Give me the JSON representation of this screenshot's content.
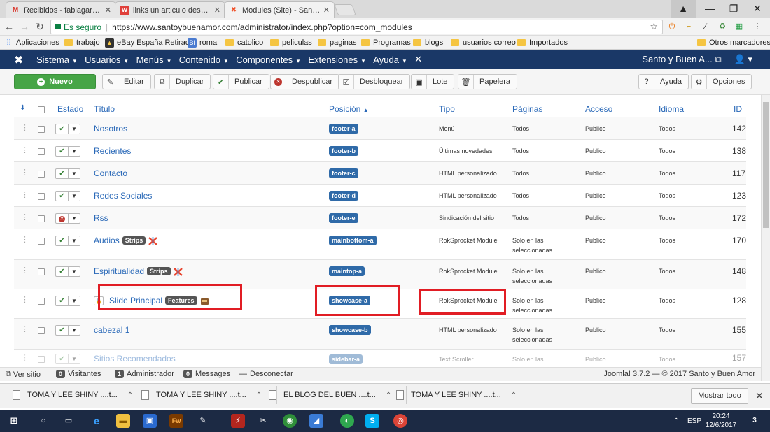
{
  "browser": {
    "tabs": [
      {
        "label": "Recibidos - fabiagarre@...",
        "icon": "gmail-icon",
        "active": false
      },
      {
        "label": "links un articulo desde u...",
        "icon": "wattpad-icon",
        "active": false
      },
      {
        "label": "Modules (Site) - Santo y...",
        "icon": "joomla-icon",
        "active": true
      }
    ],
    "secure_label": "Es seguro",
    "url": "https://www.santoybuenamor.com/administrator/index.php?option=com_modules",
    "bookmarks": [
      "Aplicaciones",
      "trabajo",
      "eBay España Retirad",
      "roma",
      "catolico",
      "peliculas",
      "paginas",
      "Programas",
      "blogs",
      "usuarios correo",
      "Importados"
    ],
    "other_bookmarks": "Otros marcadores"
  },
  "joomla": {
    "menu": [
      "Sistema",
      "Usuarios",
      "Menús",
      "Contenido",
      "Componentes",
      "Extensiones",
      "Ayuda"
    ],
    "site_name": "Santo y Buen A...",
    "toolbar": {
      "new": "Nuevo",
      "edit": "Editar",
      "duplicate": "Duplicar",
      "publish": "Publicar",
      "unpublish": "Despublicar",
      "unlock": "Desbloquear",
      "batch": "Lote",
      "trash": "Papelera",
      "help": "Ayuda",
      "options": "Opciones"
    },
    "table": {
      "headers": {
        "status": "Estado",
        "title": "Título",
        "position": "Posición",
        "type": "Tipo",
        "pages": "Páginas",
        "access": "Acceso",
        "language": "Idioma",
        "id": "ID"
      },
      "rows": [
        {
          "title": "Nosotros",
          "badge": "",
          "position": "footer-a",
          "type": "Menú",
          "pages": "Todos",
          "pages2": "",
          "access": "Publico",
          "language": "Todos",
          "id": "142",
          "published": true
        },
        {
          "title": "Recientes",
          "badge": "",
          "position": "footer-b",
          "type": "Últimas novedades",
          "pages": "Todos",
          "pages2": "",
          "access": "Publico",
          "language": "Todos",
          "id": "138",
          "published": true
        },
        {
          "title": "Contacto",
          "badge": "",
          "position": "footer-c",
          "type": "HTML personalizado",
          "pages": "Todos",
          "pages2": "",
          "access": "Publico",
          "language": "Todos",
          "id": "117",
          "published": true
        },
        {
          "title": "Redes Sociales",
          "badge": "",
          "position": "footer-d",
          "type": "HTML personalizado",
          "pages": "Todos",
          "pages2": "",
          "access": "Publico",
          "language": "Todos",
          "id": "123",
          "published": true
        },
        {
          "title": "Rss",
          "badge": "",
          "position": "footer-e",
          "type": "Sindicación del sitio",
          "pages": "Todos",
          "pages2": "",
          "access": "Publico",
          "language": "Todos",
          "id": "172",
          "published": false
        },
        {
          "title": "Audios",
          "badge": "Strips",
          "position": "mainbottom-a",
          "type": "RokSprocket Module",
          "pages": "Solo en las",
          "pages2": "seleccionadas",
          "access": "Publico",
          "language": "Todos",
          "id": "170",
          "published": true
        },
        {
          "title": "Espiritualidad",
          "badge": "Strips",
          "position": "maintop-a",
          "type": "RokSprocket Module",
          "pages": "Solo en las",
          "pages2": "seleccionadas",
          "access": "Publico",
          "language": "Todos",
          "id": "148",
          "published": true
        },
        {
          "title": "Slide Principal",
          "badge": "Features",
          "position": "showcase-a",
          "type": "RokSprocket Module",
          "pages": "Solo en las",
          "pages2": "seleccionadas",
          "access": "Publico",
          "language": "Todos",
          "id": "128",
          "published": true
        },
        {
          "title": "cabezal 1",
          "badge": "",
          "position": "showcase-b",
          "type": "HTML personalizado",
          "pages": "Solo en las",
          "pages2": "seleccionadas",
          "access": "Publico",
          "language": "Todos",
          "id": "155",
          "published": true
        },
        {
          "title": "Sitios Recomendados",
          "badge": "",
          "position": "sidebar-a",
          "type": "Text Scroller",
          "pages": "Solo en las",
          "pages2": "",
          "access": "Publico",
          "language": "Todos",
          "id": "157",
          "published": true
        }
      ]
    },
    "footer": {
      "view_site": "Ver sitio",
      "visitors_count": "0",
      "visitors": "Visitantes",
      "admin_count": "1",
      "admin": "Administrador",
      "messages_count": "0",
      "messages": "Messages",
      "logout": "Desconectar",
      "copyright": "Joomla! 3.7.2 — © 2017 Santo y Buen Amor"
    }
  },
  "downloads": {
    "items": [
      "TOMA Y LEE SHINY ....t...",
      "TOMA Y LEE SHINY ....t...",
      "EL BLOG DEL BUEN ....t...",
      "TOMA Y LEE SHINY ....t..."
    ],
    "show_all": "Mostrar todo"
  },
  "taskbar": {
    "language": "ESP",
    "time": "20:24",
    "date": "12/6/2017",
    "notifications": "3"
  },
  "colors": {
    "joomla_nav": "#1a3867",
    "new_button": "#46a546",
    "position_badge": "#2f6aa8",
    "highlight": "#e11d24"
  }
}
